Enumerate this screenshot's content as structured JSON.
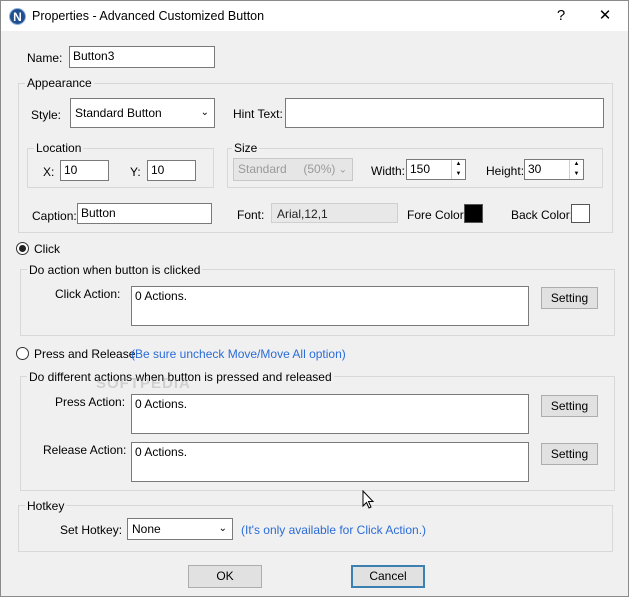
{
  "window": {
    "title": "Properties - Advanced Customized Button",
    "help_label": "?",
    "close_label": "✕",
    "app_icon_letter": "N"
  },
  "name": {
    "label": "Name:",
    "value": "Button3"
  },
  "appearance": {
    "title": "Appearance",
    "style_label": "Style:",
    "style_value": "Standard Button",
    "hint_label": "Hint Text:",
    "hint_value": "",
    "location": {
      "title": "Location",
      "x_label": "X:",
      "x_value": "10",
      "y_label": "Y:",
      "y_value": "10"
    },
    "size": {
      "title": "Size",
      "preset_value": "Standard     (50%)",
      "width_label": "Width:",
      "width_value": "150",
      "height_label": "Height:",
      "height_value": "30"
    },
    "caption_label": "Caption:",
    "caption_value": "Button",
    "font_label": "Font:",
    "font_value": "Arial,12,1",
    "fore_color_label": "Fore Color:",
    "fore_color": "#000000",
    "back_color_label": "Back Color:",
    "back_color": "#ffffff"
  },
  "click": {
    "radio_label": "Click",
    "checked": true,
    "group_title": "Do action when button is clicked",
    "action_label": "Click Action:",
    "action_value": "0 Actions.",
    "setting_label": "Setting"
  },
  "press_release": {
    "radio_label": "Press and Release",
    "checked": false,
    "note": "(Be sure uncheck Move/Move All option)",
    "group_title": "Do different actions when button is pressed and released",
    "press_label": "Press Action:",
    "press_value": "0 Actions.",
    "press_setting_label": "Setting",
    "release_label": "Release Action:",
    "release_value": "0 Actions.",
    "release_setting_label": "Setting"
  },
  "hotkey": {
    "title": "Hotkey",
    "set_label": "Set Hotkey:",
    "value": "None",
    "note": "(It's only available for Click Action.)"
  },
  "footer": {
    "ok_label": "OK",
    "cancel_label": "Cancel"
  },
  "watermark_text": "SOFTPEDIA"
}
